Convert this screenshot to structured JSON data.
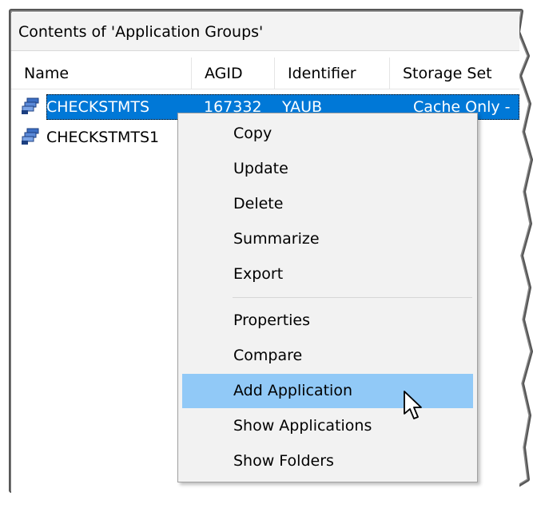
{
  "pane": {
    "title": "Contents of 'Application Groups'"
  },
  "columns": [
    {
      "label": "Name"
    },
    {
      "label": "AGID"
    },
    {
      "label": "Identifier"
    },
    {
      "label": "Storage Set"
    }
  ],
  "rows": [
    {
      "name": "CHECKSTMTS",
      "agid": "167332",
      "identifier": "YAUB",
      "storage_set": "Cache Only - ",
      "icon": "application-group-icon",
      "selected": true
    },
    {
      "name": "CHECKSTMTS1",
      "agid": "",
      "identifier": "",
      "storage_set": "",
      "icon": "application-group-icon",
      "selected": false
    }
  ],
  "context_menu": {
    "items": [
      {
        "label": "Copy"
      },
      {
        "label": "Update"
      },
      {
        "label": "Delete"
      },
      {
        "label": "Summarize"
      },
      {
        "label": "Export"
      },
      {
        "label": "Properties"
      },
      {
        "label": "Compare"
      },
      {
        "label": "Add Application",
        "highlighted": true
      },
      {
        "label": "Show Applications"
      },
      {
        "label": "Show Folders"
      }
    ]
  },
  "colors": {
    "selection": "#0078d7",
    "menu_hover": "#91c9f7",
    "menu_background": "#f2f2f2"
  }
}
